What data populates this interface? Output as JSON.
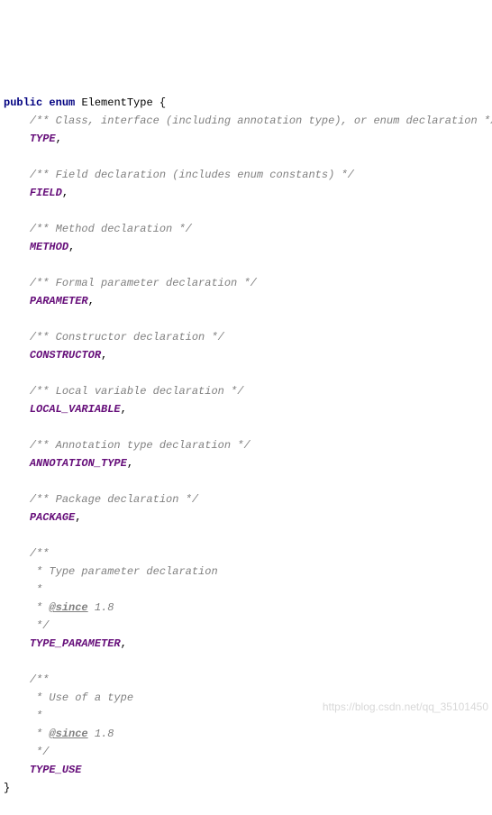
{
  "code": {
    "l01": {
      "kw1": "public",
      "kw2": "enum",
      "cls": "ElementType",
      "brace": "{"
    },
    "l02": {
      "cmt": "/** Class, interface (including annotation type), or enum declaration */"
    },
    "l03": {
      "id": "TYPE",
      "p": ","
    },
    "l04": {
      "cmt": "/** Field declaration (includes enum constants) */"
    },
    "l05": {
      "id": "FIELD",
      "p": ","
    },
    "l06": {
      "cmt": "/** Method declaration */"
    },
    "l07": {
      "id": "METHOD",
      "p": ","
    },
    "l08": {
      "cmt": "/** Formal parameter declaration */"
    },
    "l09": {
      "id": "PARAMETER",
      "p": ","
    },
    "l10": {
      "cmt": "/** Constructor declaration */"
    },
    "l11": {
      "id": "CONSTRUCTOR",
      "p": ","
    },
    "l12": {
      "cmt": "/** Local variable declaration */"
    },
    "l13": {
      "id": "LOCAL_VARIABLE",
      "p": ","
    },
    "l14": {
      "cmt": "/** Annotation type declaration */"
    },
    "l15": {
      "id": "ANNOTATION_TYPE",
      "p": ","
    },
    "l16": {
      "cmt": "/** Package declaration */"
    },
    "l17": {
      "id": "PACKAGE",
      "p": ","
    },
    "l18": {
      "cmt": "/**"
    },
    "l19": {
      "cmt": " * Type parameter declaration"
    },
    "l20": {
      "cmt": " *"
    },
    "l21": {
      "pre": " * ",
      "tag": "@since",
      "post": " 1.8"
    },
    "l22": {
      "cmt": " */"
    },
    "l23": {
      "id": "TYPE_PARAMETER",
      "p": ","
    },
    "l24": {
      "cmt": "/**"
    },
    "l25": {
      "cmt": " * Use of a type"
    },
    "l26": {
      "cmt": " *"
    },
    "l27": {
      "pre": " * ",
      "tag": "@since",
      "post": " 1.8"
    },
    "l28": {
      "cmt": " */"
    },
    "l29": {
      "id": "TYPE_USE"
    },
    "l30": {
      "brace": "}"
    }
  },
  "watermark": "https://blog.csdn.net/qq_35101450"
}
